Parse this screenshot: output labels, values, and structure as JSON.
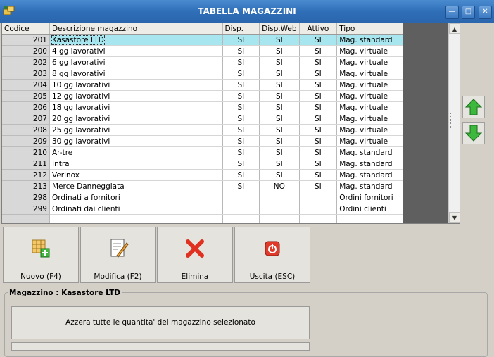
{
  "window": {
    "title": "TABELLA MAGAZZINI"
  },
  "table": {
    "columns": [
      "Codice",
      "Descrizione magazzino",
      "Disp.",
      "Disp.Web",
      "Attivo",
      "Tipo"
    ],
    "rows": [
      {
        "codice": "201",
        "descrizione": "Kasastore LTD",
        "disp": "SI",
        "disp_web": "SI",
        "attivo": "SI",
        "tipo": "Mag. standard"
      },
      {
        "codice": "200",
        "descrizione": "4 gg lavorativi",
        "disp": "SI",
        "disp_web": "SI",
        "attivo": "SI",
        "tipo": "Mag. virtuale"
      },
      {
        "codice": "202",
        "descrizione": "6 gg lavorativi",
        "disp": "SI",
        "disp_web": "SI",
        "attivo": "SI",
        "tipo": "Mag. virtuale"
      },
      {
        "codice": "203",
        "descrizione": "8 gg lavorativi",
        "disp": "SI",
        "disp_web": "SI",
        "attivo": "SI",
        "tipo": "Mag. virtuale"
      },
      {
        "codice": "204",
        "descrizione": "10 gg lavorativi",
        "disp": "SI",
        "disp_web": "SI",
        "attivo": "SI",
        "tipo": "Mag. virtuale"
      },
      {
        "codice": "205",
        "descrizione": "12 gg lavorativi",
        "disp": "SI",
        "disp_web": "SI",
        "attivo": "SI",
        "tipo": "Mag. virtuale"
      },
      {
        "codice": "206",
        "descrizione": "18 gg lavorativi",
        "disp": "SI",
        "disp_web": "SI",
        "attivo": "SI",
        "tipo": "Mag. virtuale"
      },
      {
        "codice": "207",
        "descrizione": "20 gg lavorativi",
        "disp": "SI",
        "disp_web": "SI",
        "attivo": "SI",
        "tipo": "Mag. virtuale"
      },
      {
        "codice": "208",
        "descrizione": "25 gg lavorativi",
        "disp": "SI",
        "disp_web": "SI",
        "attivo": "SI",
        "tipo": "Mag. virtuale"
      },
      {
        "codice": "209",
        "descrizione": "30 gg lavorativi",
        "disp": "SI",
        "disp_web": "SI",
        "attivo": "SI",
        "tipo": "Mag. virtuale"
      },
      {
        "codice": "210",
        "descrizione": "Ar-tre",
        "disp": "SI",
        "disp_web": "SI",
        "attivo": "SI",
        "tipo": "Mag. standard"
      },
      {
        "codice": "211",
        "descrizione": "Intra",
        "disp": "SI",
        "disp_web": "SI",
        "attivo": "SI",
        "tipo": "Mag. standard"
      },
      {
        "codice": "212",
        "descrizione": "Verinox",
        "disp": "SI",
        "disp_web": "SI",
        "attivo": "SI",
        "tipo": "Mag. standard"
      },
      {
        "codice": "213",
        "descrizione": "Merce Danneggiata",
        "disp": "SI",
        "disp_web": "NO",
        "attivo": "SI",
        "tipo": "Mag. standard"
      },
      {
        "codice": "298",
        "descrizione": "Ordinati a fornitori",
        "disp": "",
        "disp_web": "",
        "attivo": "",
        "tipo": "Ordini fornitori"
      },
      {
        "codice": "299",
        "descrizione": "Ordinati dai clienti",
        "disp": "",
        "disp_web": "",
        "attivo": "",
        "tipo": "Ordini clienti"
      }
    ],
    "selected_index": 0,
    "selection_color": "#a7e6ee"
  },
  "side_buttons": {
    "up_icon": "green-up-arrow-icon",
    "down_icon": "green-down-arrow-icon"
  },
  "toolbar": {
    "nuovo": "Nuovo (F4)",
    "modifica": "Modifica (F2)",
    "elimina": "Elimina",
    "uscita": "Uscita (ESC)"
  },
  "group": {
    "label": "Magazzino : Kasastore LTD",
    "reset_button": "Azzera tutte le quantita' del magazzino selezionato"
  }
}
